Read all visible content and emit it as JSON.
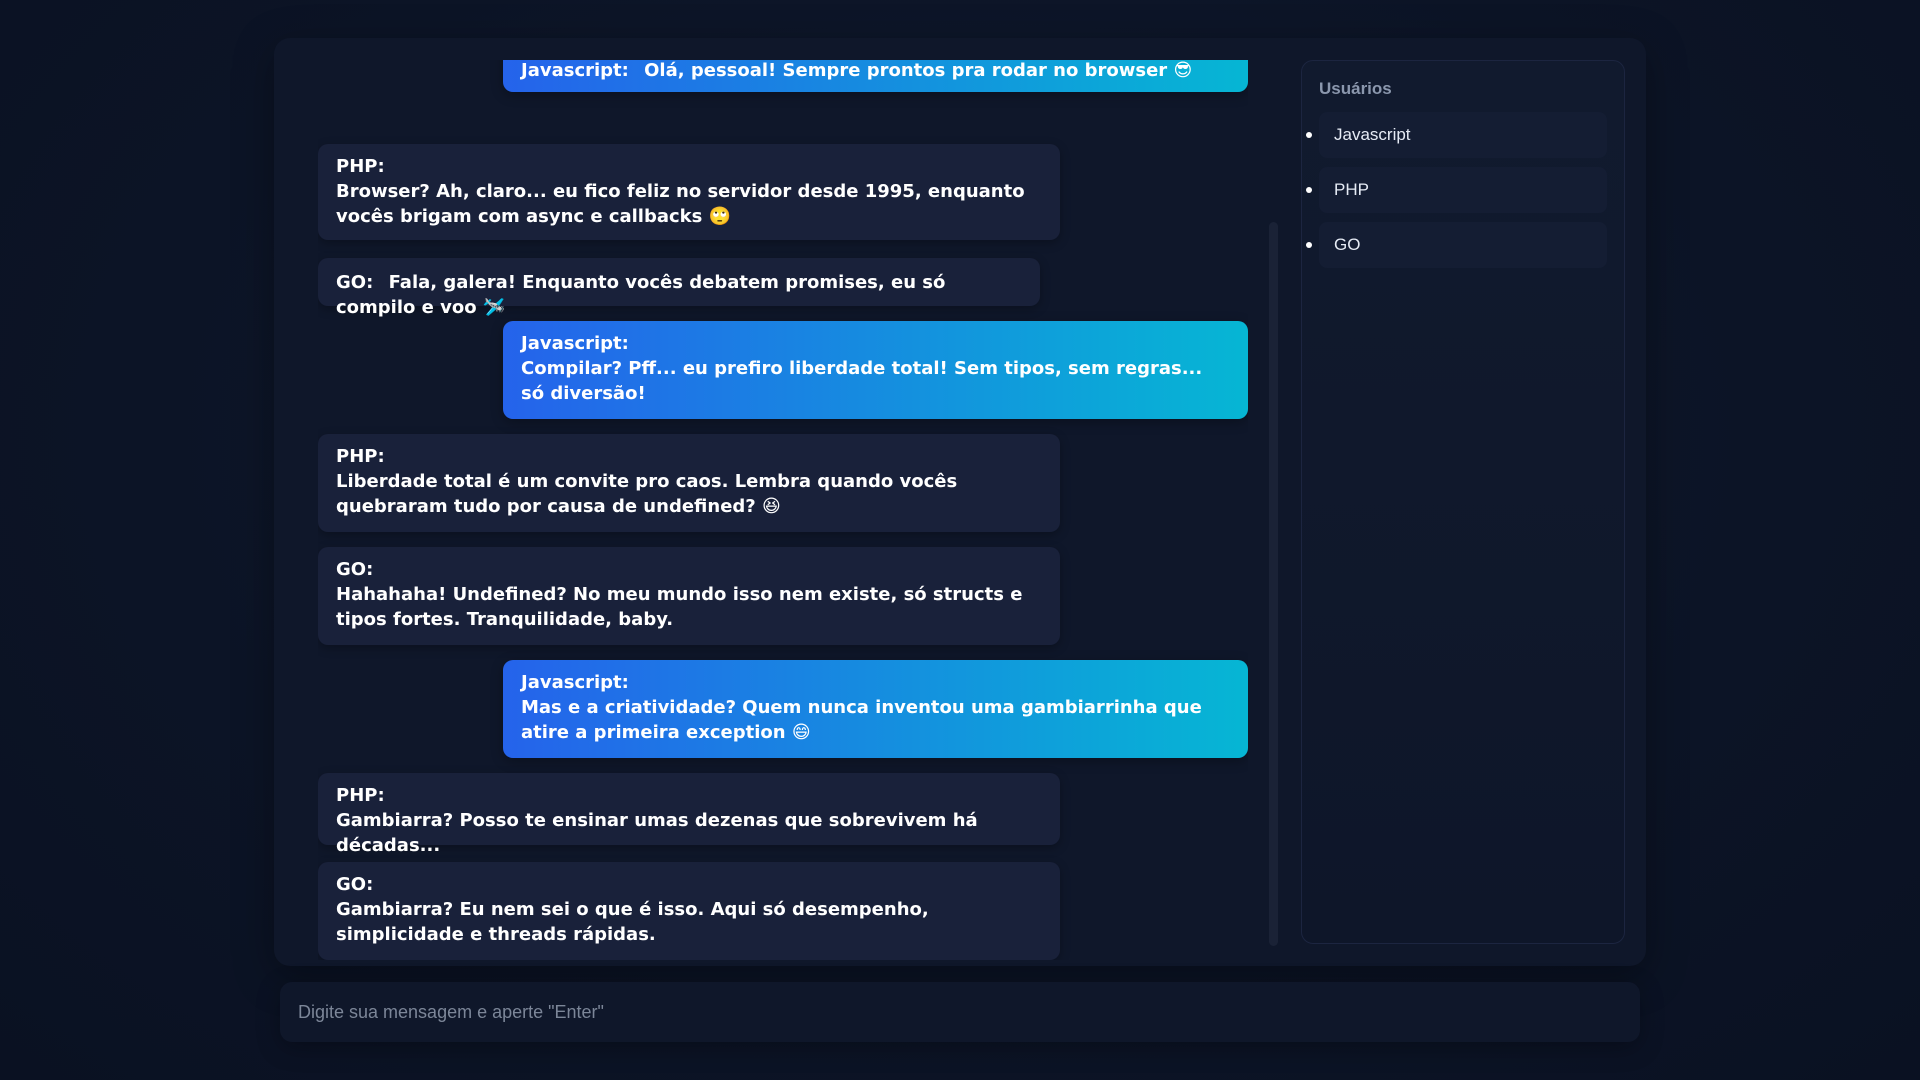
{
  "chat": {
    "messages": [
      {
        "sender": "Javascript:",
        "text": "Olá, pessoal! Sempre prontos pra rodar no browser 😎",
        "mine": true
      },
      {
        "sender": "PHP:",
        "text": "Browser? Ah, claro... eu fico feliz no servidor desde 1995, enquanto vocês brigam com async e callbacks 🙄",
        "mine": false
      },
      {
        "sender": "GO:",
        "text": "Fala, galera! Enquanto vocês debatem promises, eu só compilo e voo 🛩️",
        "mine": false
      },
      {
        "sender": "Javascript:",
        "text": "Compilar? Pff... eu prefiro liberdade total! Sem tipos, sem regras... só diversão!",
        "mine": true
      },
      {
        "sender": "PHP:",
        "text": "Liberdade total é um convite pro caos. Lembra quando vocês quebraram tudo por causa de undefined? 😆",
        "mine": false
      },
      {
        "sender": "GO:",
        "text": "Hahahaha! Undefined? No meu mundo isso nem existe, só structs e tipos fortes. Tranquilidade, baby.",
        "mine": false
      },
      {
        "sender": "Javascript:",
        "text": "Mas e a criatividade? Quem nunca inventou uma gambiarrinha que atire a primeira exception 😄",
        "mine": true
      },
      {
        "sender": "PHP:",
        "text": "Gambiarra? Posso te ensinar umas dezenas que sobrevivem há décadas...",
        "mine": false
      },
      {
        "sender": "GO:",
        "text": "Gambiarra? Eu nem sei o que é isso. Aqui só desempenho, simplicidade e threads rápidas.",
        "mine": false
      }
    ]
  },
  "users": {
    "title": "Usuários",
    "items": [
      "Javascript",
      "PHP",
      "GO"
    ]
  },
  "input": {
    "placeholder": "Digite sua mensagem e aperte \"Enter\""
  },
  "colors": {
    "background": "#0c1426",
    "panel": "#0f172a",
    "bubble_other": "#19213a",
    "bubble_mine_start": "#2563eb",
    "bubble_mine_end": "#06b6d4",
    "muted_text": "#8b97ad"
  }
}
